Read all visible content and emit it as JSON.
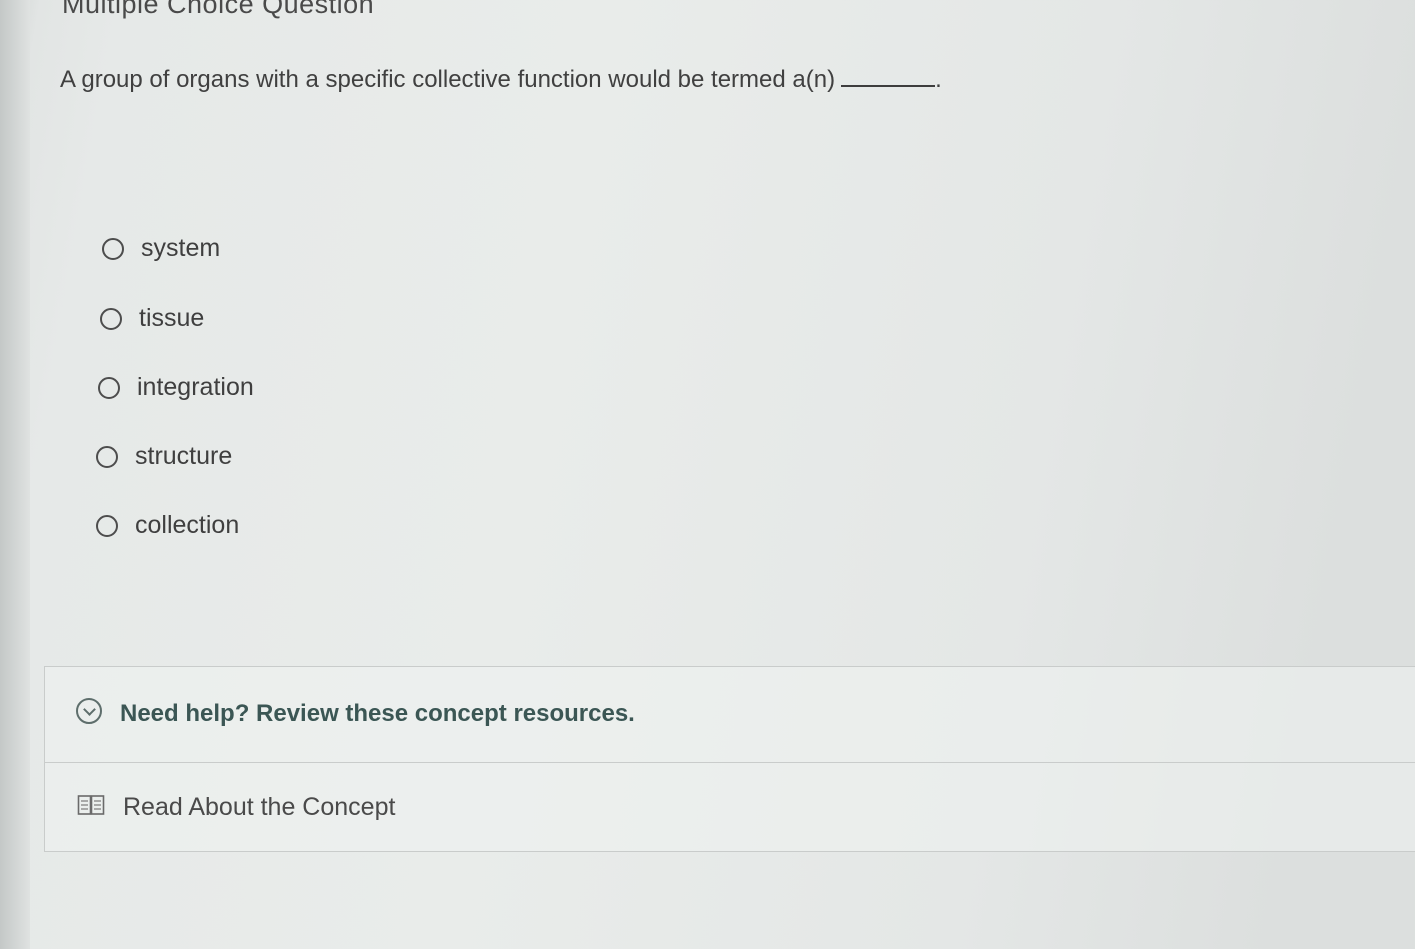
{
  "header": {
    "title": "Multiple Choice Question"
  },
  "question": {
    "text": "A group of organs with a specific collective function would be termed a(n)",
    "suffix": "."
  },
  "options": [
    {
      "label": "system"
    },
    {
      "label": "tissue"
    },
    {
      "label": "integration"
    },
    {
      "label": "structure"
    },
    {
      "label": "collection"
    }
  ],
  "help": {
    "toggle_label": "Need help? Review these concept resources.",
    "resources": [
      {
        "label": "Read About the Concept",
        "icon": "book-icon"
      }
    ]
  },
  "colors": {
    "help_text": "#3b5654",
    "background": "#e6e9e8"
  }
}
